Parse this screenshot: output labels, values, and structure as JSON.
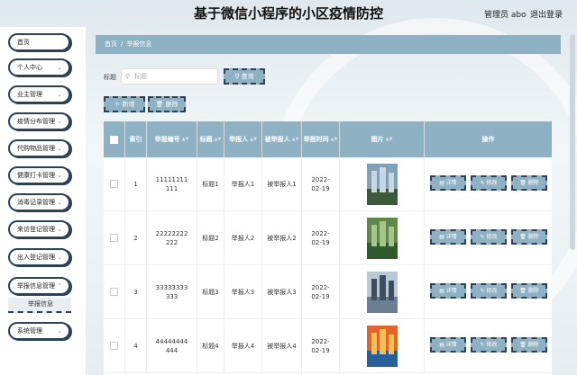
{
  "header": {
    "title": "基于微信小程序的小区疫情防控",
    "user": "管理员 abo",
    "logout": "退出登录"
  },
  "sidebar": {
    "items": [
      {
        "label": "首页",
        "chevron": false
      },
      {
        "label": "个人中心",
        "chevron": true
      },
      {
        "label": "业主管理",
        "chevron": true
      },
      {
        "label": "疫情分布管理",
        "chevron": true
      },
      {
        "label": "代购物品管理",
        "chevron": true
      },
      {
        "label": "健康打卡管理",
        "chevron": true
      },
      {
        "label": "消毒记录管理",
        "chevron": true
      },
      {
        "label": "来访登记管理",
        "chevron": true
      },
      {
        "label": "出入登记管理",
        "chevron": true
      },
      {
        "label": "举报信息管理",
        "chevron": true
      },
      {
        "label": "系统管理",
        "chevron": true
      }
    ],
    "subitem": "举报信息"
  },
  "breadcrumb": {
    "home": "首页",
    "sep": "/",
    "current": "举报信息"
  },
  "search": {
    "label": "标题",
    "placeholder": "标题",
    "button": "查询"
  },
  "actions": {
    "add": "新增",
    "delete": "删除"
  },
  "table": {
    "headers": [
      "索引",
      "举报编号",
      "标题",
      "举报人",
      "被举报人",
      "举报时间",
      "图片",
      "操作"
    ],
    "rows": [
      {
        "index": "1",
        "code": "11111111111",
        "title": "标题1",
        "reporter": "举报人1",
        "reported": "被举报人1",
        "time": "2022-02-19"
      },
      {
        "index": "2",
        "code": "22222222222",
        "title": "标题2",
        "reporter": "举报人2",
        "reported": "被举报人2",
        "time": "2022-02-19"
      },
      {
        "index": "3",
        "code": "33333333333",
        "title": "标题3",
        "reporter": "举报人3",
        "reported": "被举报人3",
        "time": "2022-02-19"
      },
      {
        "index": "4",
        "code": "44444444444",
        "title": "标题4",
        "reporter": "举报人4",
        "reported": "被举报人4",
        "time": "2022-02-19"
      }
    ],
    "row_actions": {
      "detail": "详情",
      "edit": "修改",
      "delete": "删除"
    }
  },
  "colors": {
    "accent": "#8eb1c4",
    "border": "#2b4256"
  }
}
